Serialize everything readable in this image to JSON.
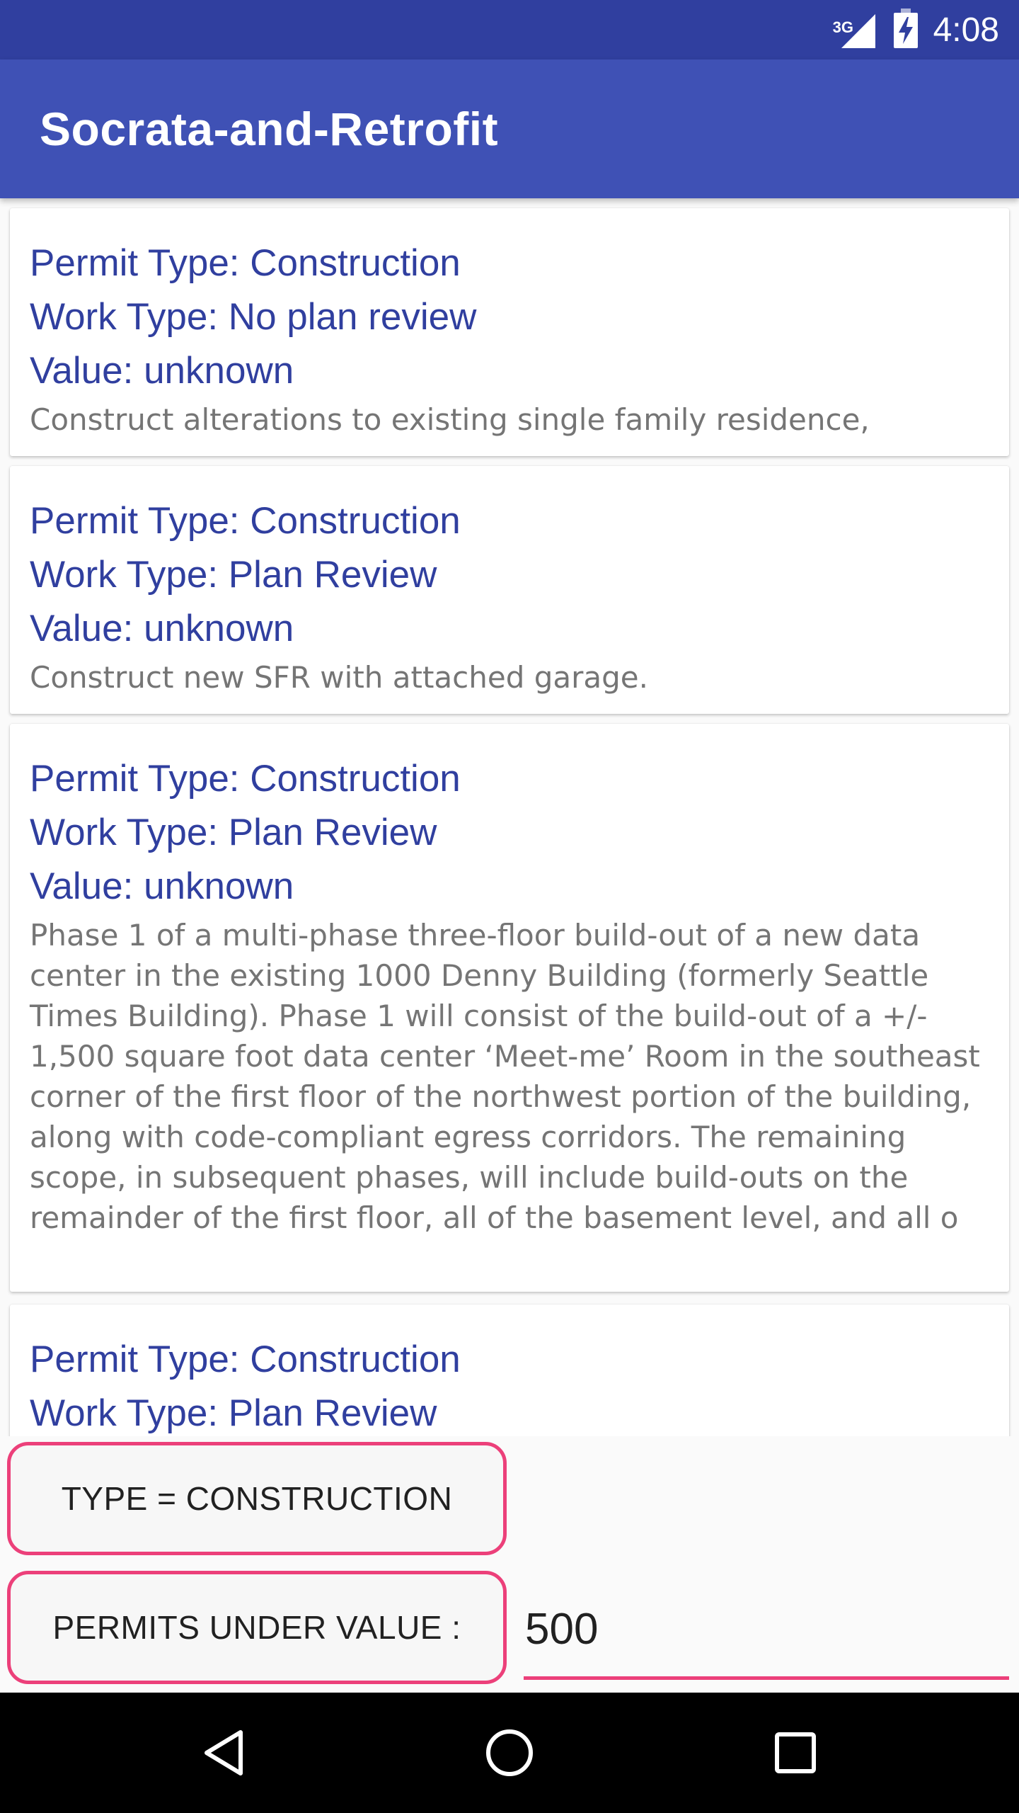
{
  "status_bar": {
    "network_type": "3G",
    "time": "4:08",
    "icons": [
      "signal-icon",
      "battery-charging-icon"
    ]
  },
  "app_bar": {
    "title": "Socrata-and-Retrofit"
  },
  "permits": [
    {
      "permit_type": "Permit Type: Construction",
      "work_type": "Work Type: No plan review",
      "value": "Value: unknown",
      "description": "Construct alterations to existing single family residence,"
    },
    {
      "permit_type": "Permit Type: Construction",
      "work_type": "Work Type: Plan Review",
      "value": "Value: unknown",
      "description": "Construct new SFR with attached garage."
    },
    {
      "permit_type": "Permit Type: Construction",
      "work_type": "Work Type: Plan Review",
      "value": "Value: unknown",
      "description": "Phase 1 of a multi-phase three-floor build-out of a new data center in the existing 1000 Denny Building (formerly Seattle Times Building). Phase 1 will consist of the build-out of a +/- 1,500 square foot data center ‘Meet-me’ Room in the southeast corner of the first floor of the northwest portion of the building, along with code-compliant egress corridors. The remaining scope, in subsequent phases, will include build-outs on the remainder of the first floor, all of the basement level, and all o"
    },
    {
      "permit_type": "Permit Type: Construction",
      "work_type": "Work Type: Plan Review"
    }
  ],
  "controls": {
    "type_button_label": "TYPE = CONSTRUCTION",
    "value_button_label": "PERMITS UNDER VALUE :",
    "value_input": "500"
  },
  "navigation": {
    "icons": [
      "back-icon",
      "home-icon",
      "recents-icon"
    ]
  },
  "colors": {
    "status_bar": "#303f9f",
    "app_bar": "#3f51b5",
    "accent": "#ec407a",
    "card_text": "#303f9f",
    "description_text": "#757575"
  }
}
